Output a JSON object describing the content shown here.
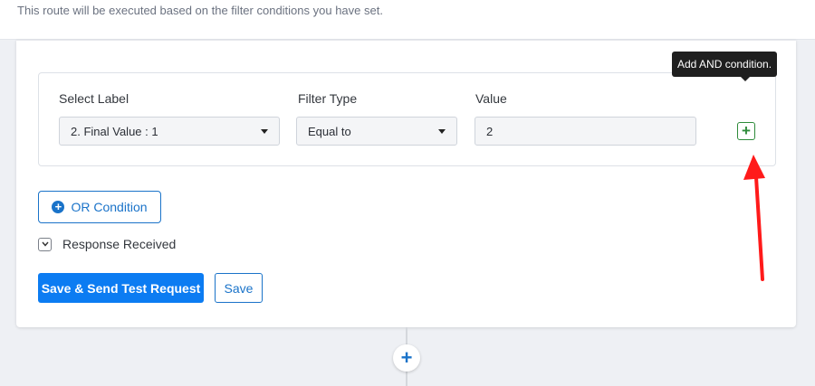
{
  "header": {
    "description": "This route will be executed based on the filter conditions you have set."
  },
  "filter": {
    "label_header": "Select Label",
    "type_header": "Filter Type",
    "value_header": "Value",
    "selected_label": "2. Final Value : 1",
    "selected_type": "Equal to",
    "value": "2",
    "add_and_symbol": "+",
    "add_and_tooltip": "Add AND condition."
  },
  "or_condition": {
    "label": "OR Condition",
    "icon": "plus-circle-icon"
  },
  "response": {
    "label": "Response Received",
    "icon": "chevron-down-icon"
  },
  "actions": {
    "save_send_label": "Save & Send Test Request",
    "save_label": "Save"
  },
  "flow": {
    "add_step_symbol": "+"
  },
  "colors": {
    "primary": "#0c7cf2",
    "accent_blue": "#1a73c9",
    "and_green": "#2e8b3a",
    "annotation_red": "#ff1a1a"
  }
}
